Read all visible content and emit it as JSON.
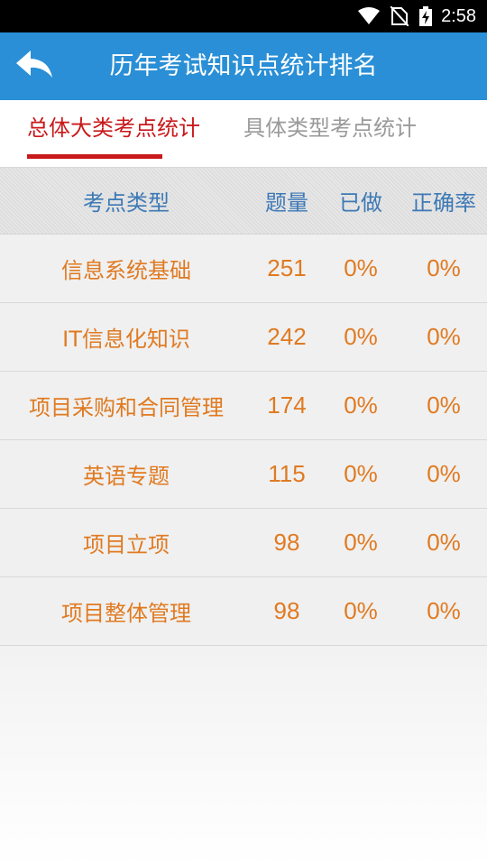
{
  "status_bar": {
    "time": "2:58"
  },
  "app_bar": {
    "title": "历年考试知识点统计排名"
  },
  "tabs": [
    {
      "label": "总体大类考点统计",
      "active": true
    },
    {
      "label": "具体类型考点统计",
      "active": false
    }
  ],
  "table": {
    "headers": [
      "考点类型",
      "题量",
      "已做",
      "正确率"
    ],
    "rows": [
      {
        "type": "信息系统基础",
        "count": "251",
        "done": "0%",
        "accuracy": "0%"
      },
      {
        "type": "IT信息化知识",
        "count": "242",
        "done": "0%",
        "accuracy": "0%"
      },
      {
        "type": "项目采购和合同管理",
        "count": "174",
        "done": "0%",
        "accuracy": "0%"
      },
      {
        "type": "英语专题",
        "count": "115",
        "done": "0%",
        "accuracy": "0%"
      },
      {
        "type": "项目立项",
        "count": "98",
        "done": "0%",
        "accuracy": "0%"
      },
      {
        "type": "项目整体管理",
        "count": "98",
        "done": "0%",
        "accuracy": "0%"
      }
    ]
  },
  "colors": {
    "app_bar": "#2a8fd6",
    "active_tab": "#c8191b",
    "header_text": "#3d79b5",
    "cell_text": "#e07a21"
  }
}
